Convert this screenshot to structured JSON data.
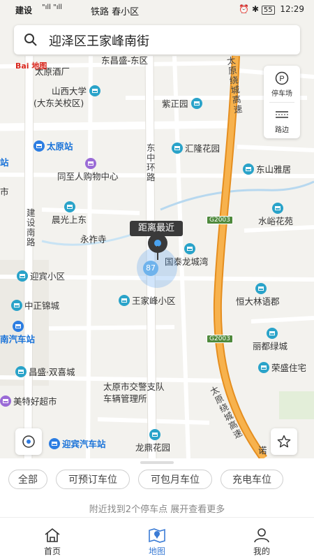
{
  "status_bar": {
    "carrier": "建设",
    "signal": "\"ıll \"ıll",
    "center_text": "铁路 春小区",
    "battery": "55",
    "time": "12:29"
  },
  "search": {
    "text": "迎泽区王家峰南街"
  },
  "side_panel": {
    "parking_label": "停车场",
    "roadside_label": "路边",
    "parking_icon_glyph": "P"
  },
  "map": {
    "logo": "Bai 地图",
    "pois": [
      {
        "label": "东昌盛-东区",
        "style": "normal"
      },
      {
        "label": "太原酒厂",
        "style": "normal"
      },
      {
        "label": "山西大学",
        "style": "normal"
      },
      {
        "label": "(大东关校区)",
        "style": "normal"
      },
      {
        "label": "紫正园",
        "style": "normal"
      },
      {
        "label": "太原站",
        "style": "blue"
      },
      {
        "label": "汇隆花园",
        "style": "normal"
      },
      {
        "label": "同至人购物中心",
        "style": "normal"
      },
      {
        "label": "东山雅居",
        "style": "normal"
      },
      {
        "label": "晨光上东",
        "style": "normal"
      },
      {
        "label": "水峪花苑",
        "style": "normal"
      },
      {
        "label": "永祚寺",
        "style": "normal"
      },
      {
        "label": "国泰龙城湾",
        "style": "normal"
      },
      {
        "label": "迎宾小区",
        "style": "normal"
      },
      {
        "label": "王家峰小区",
        "style": "normal"
      },
      {
        "label": "中正锦城",
        "style": "normal"
      },
      {
        "label": "恒大林语郡",
        "style": "normal"
      },
      {
        "label": "南汽车站",
        "style": "blue"
      },
      {
        "label": "丽都绿城",
        "style": "normal"
      },
      {
        "label": "昌盛·双喜城",
        "style": "normal"
      },
      {
        "label": "荣盛住宅",
        "style": "normal"
      },
      {
        "label": "太原市交警支队",
        "style": "normal"
      },
      {
        "label": "车辆管理所",
        "style": "normal"
      },
      {
        "label": "美特好超市",
        "style": "normal"
      },
      {
        "label": "迎宾汽车站",
        "style": "blue"
      },
      {
        "label": "龙鼎花园",
        "style": "normal"
      },
      {
        "label": "诺",
        "style": "normal"
      },
      {
        "label": "站",
        "style": "blue"
      },
      {
        "label": "市",
        "style": "normal"
      }
    ],
    "road_labels": {
      "expressway_upper": "太原绕城高速",
      "expressway_lower": "太原绕城高速",
      "ring_road": "东中环路",
      "jianshe_road": "建设南路"
    },
    "shields": [
      "G2003",
      "G2003"
    ],
    "callout": "距离最近",
    "marker_count": "87"
  },
  "filters": {
    "chips": [
      "全部",
      "可预订车位",
      "可包月车位",
      "充电车位"
    ]
  },
  "hint": "附近找到2个停车点 展开查看更多",
  "tabs": [
    {
      "label": "首页",
      "icon": "home-icon",
      "active": false
    },
    {
      "label": "地图",
      "icon": "map-icon",
      "active": true
    },
    {
      "label": "我的",
      "icon": "user-icon",
      "active": false
    }
  ],
  "colors": {
    "expressway": "#f5a442",
    "accent": "#3a7bd5",
    "poi_pin": "#2aa3c9"
  }
}
